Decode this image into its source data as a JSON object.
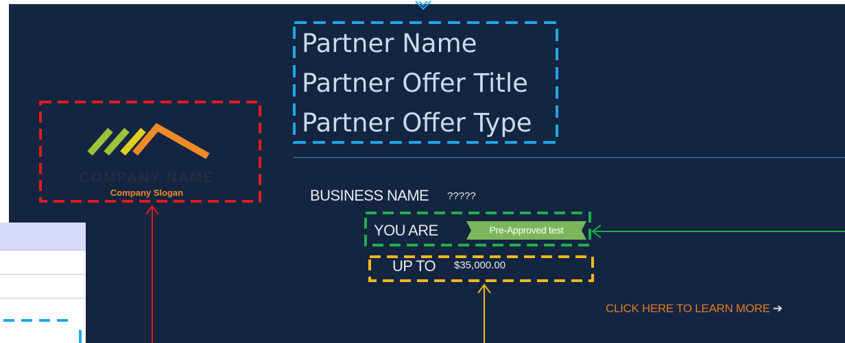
{
  "partner": {
    "name": "Partner Name",
    "offer_title": "Partner Offer Title",
    "offer_type": "Partner Offer Type"
  },
  "logo": {
    "company_name": "COMPANY NAME",
    "slogan": "Company Slogan"
  },
  "business": {
    "name_label": "BUSINESS NAME",
    "name_value": "?????",
    "you_are_label": "YOU ARE",
    "status_badge": "Pre-Approved test",
    "up_to_label": "UP TO",
    "amount": "$35,000.00"
  },
  "cta": {
    "learn_more": "CLICK HERE TO LEARN MORE",
    "arrow_icon": "arrow-right-icon"
  },
  "colors": {
    "background": "#132540",
    "partner_box": "#1fa8e6",
    "logo_box": "#e31b1b",
    "badge_box": "#1fae4c",
    "amount_box": "#f6b81c",
    "badge_fill": "#7bb65b",
    "cta": "#e07b24"
  }
}
